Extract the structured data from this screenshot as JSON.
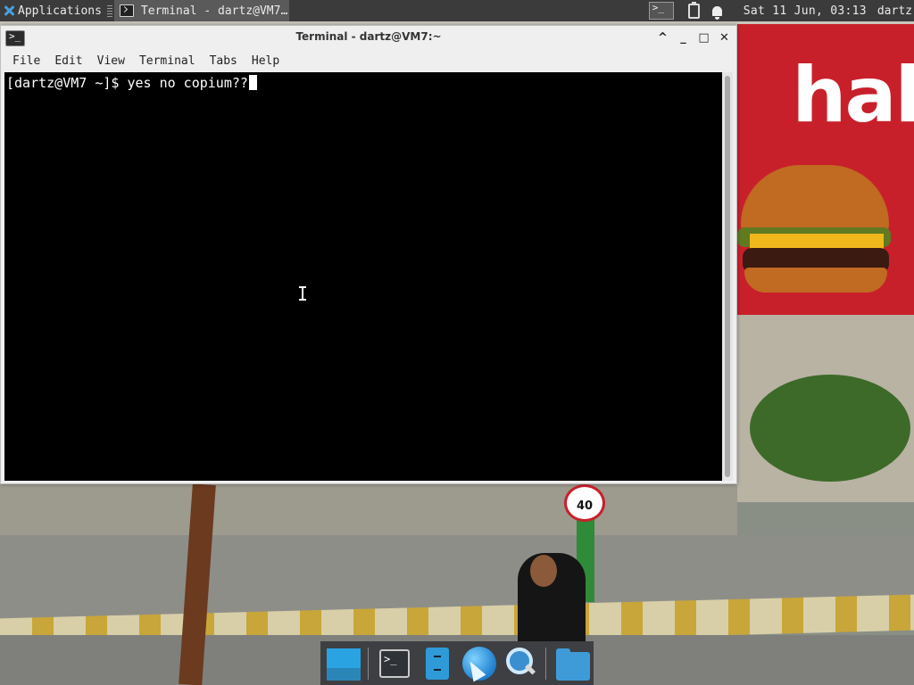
{
  "top_panel": {
    "applications_label": "Applications",
    "task_title": "Terminal - dartz@VM7…",
    "clock": "Sat 11 Jun, 03:13",
    "user": "dartz"
  },
  "terminal_window": {
    "title": "Terminal - dartz@VM7:~",
    "controls": {
      "minimize_icon": "^",
      "minimize_bar": "_",
      "maximize": "□",
      "close": "✕"
    },
    "menu": [
      "File",
      "Edit",
      "View",
      "Terminal",
      "Tabs",
      "Help"
    ],
    "prompt_line": "[dartz@VM7 ~]$ yes no copium??"
  },
  "wallpaper": {
    "billboard_text": "hal",
    "speed_sign": "40"
  },
  "dock": {
    "items": [
      "show-desktop",
      "terminal",
      "file-manager",
      "web-browser",
      "app-finder",
      "home-folder"
    ]
  },
  "colors": {
    "panel_bg": "#3b3b3b",
    "terminal_bg": "#000000",
    "terminal_fg": "#ffffff",
    "accent": "#2aa3e3"
  }
}
